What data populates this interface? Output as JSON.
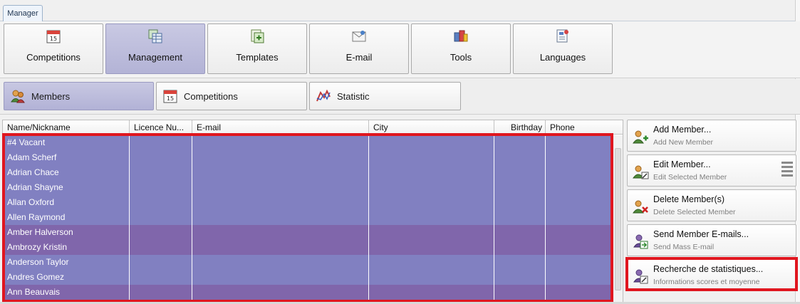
{
  "app_tab": "Manager",
  "ribbon": [
    {
      "label": "Competitions",
      "icon": "calendar-icon",
      "active": false
    },
    {
      "label": "Management",
      "icon": "table-icon",
      "active": true
    },
    {
      "label": "Templates",
      "icon": "templates-icon",
      "active": false
    },
    {
      "label": "E-mail",
      "icon": "envelope-icon",
      "active": false
    },
    {
      "label": "Tools",
      "icon": "tools-icon",
      "active": false
    },
    {
      "label": "Languages",
      "icon": "languages-icon",
      "active": false
    }
  ],
  "subtabs": [
    {
      "label": "Members",
      "icon": "members-icon",
      "active": true
    },
    {
      "label": "Competitions",
      "icon": "calendar-icon",
      "active": false
    },
    {
      "label": "Statistic",
      "icon": "statistic-icon",
      "active": false
    }
  ],
  "calendar_day": "15",
  "grid": {
    "columns": [
      "Name/Nickname",
      "Licence Nu...",
      "E-mail",
      "City",
      "Birthday",
      "Phone"
    ],
    "rows": [
      {
        "name": "#4 Vacant"
      },
      {
        "name": "Adam Scherf"
      },
      {
        "name": "Adrian Chace"
      },
      {
        "name": "Adrian Shayne"
      },
      {
        "name": "Allan Oxford"
      },
      {
        "name": "Allen Raymond"
      },
      {
        "name": "Amber Halverson"
      },
      {
        "name": "Ambrozy Kristin"
      },
      {
        "name": "Anderson Taylor"
      },
      {
        "name": "Andres Gomez"
      },
      {
        "name": "Ann Beauvais"
      }
    ],
    "row_color": "#8180c1",
    "row_alt_color": "#8066ab"
  },
  "actions": [
    {
      "title": "Add Member...",
      "subtitle": "Add New Member",
      "icon": "add-member-icon"
    },
    {
      "title": "Edit Member...",
      "subtitle": "Edit Selected Member",
      "icon": "edit-member-icon"
    },
    {
      "title": "Delete Member(s)",
      "subtitle": "Delete Selected Member",
      "icon": "delete-member-icon"
    },
    {
      "title": "Send Member E-mails...",
      "subtitle": "Send Mass E-mail",
      "icon": "send-email-icon"
    },
    {
      "title": "Recherche de statistiques...",
      "subtitle": "Informations scores et moyenne",
      "icon": "statistics-search-icon"
    }
  ],
  "highlight_color": "#e0161f"
}
